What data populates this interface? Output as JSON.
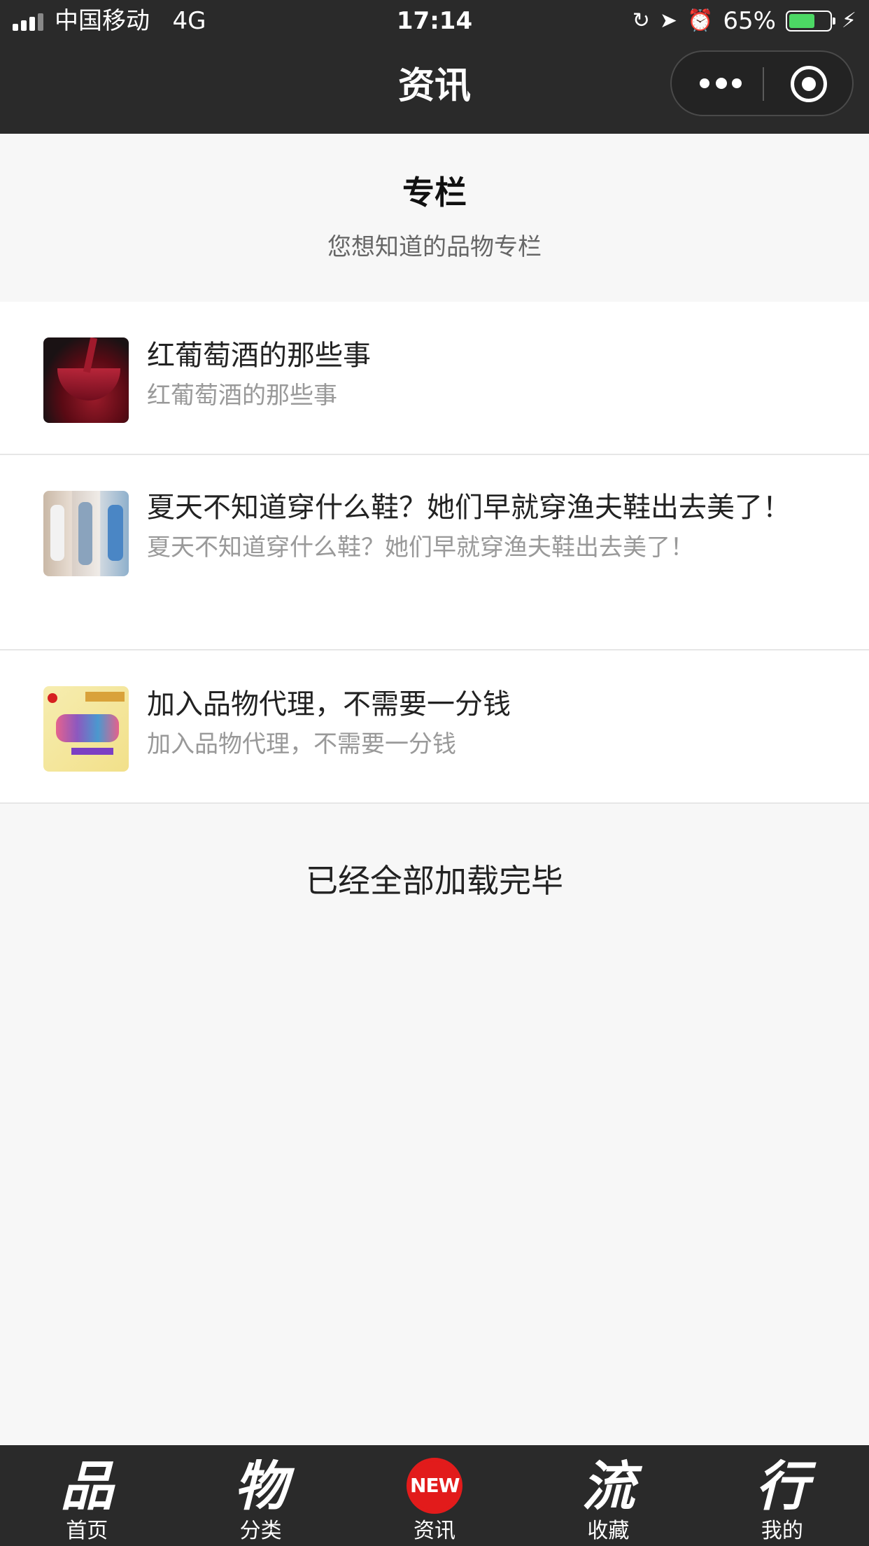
{
  "status_bar": {
    "carrier": "中国移动",
    "network": "4G",
    "time": "17:14",
    "battery_percent": "65%",
    "battery_level": 0.65,
    "icons": [
      "signal-icon",
      "orientation-lock-icon",
      "location-icon",
      "alarm-icon",
      "battery-icon",
      "charging-icon"
    ]
  },
  "nav": {
    "title": "资讯",
    "more_icon": "more-dots-icon",
    "close_icon": "target-close-icon"
  },
  "section": {
    "title": "专栏",
    "subtitle": "您想知道的品物专栏"
  },
  "articles": [
    {
      "title": "红葡萄酒的那些事",
      "summary": "红葡萄酒的那些事",
      "thumb": "red-wine-glass-image"
    },
    {
      "title": "夏天不知道穿什么鞋？她们早就穿渔夫鞋出去美了！",
      "summary": "夏天不知道穿什么鞋？她们早就穿渔夫鞋出去美了！",
      "thumb": "women-fashion-photo-image"
    },
    {
      "title": "加入品物代理，不需要一分钱",
      "summary": "加入品物代理，不需要一分钱",
      "thumb": "join-us-poster-image"
    }
  ],
  "end_text": "已经全部加载完毕",
  "tabbar": {
    "tabs": [
      {
        "glyph": "品",
        "label": "首页",
        "icon": "brush-pin-icon"
      },
      {
        "glyph": "物",
        "label": "分类",
        "icon": "brush-wu-icon"
      },
      {
        "glyph": "NEW",
        "label": "资讯",
        "icon": "new-badge-icon"
      },
      {
        "glyph": "流",
        "label": "收藏",
        "icon": "brush-liu-icon"
      },
      {
        "glyph": "行",
        "label": "我的",
        "icon": "brush-xing-icon"
      }
    ],
    "active_index": 2
  },
  "colors": {
    "bar_bg": "#2a2a2a",
    "page_bg": "#f7f7f7",
    "badge_red": "#e21b1b",
    "battery_green": "#4cd964"
  }
}
